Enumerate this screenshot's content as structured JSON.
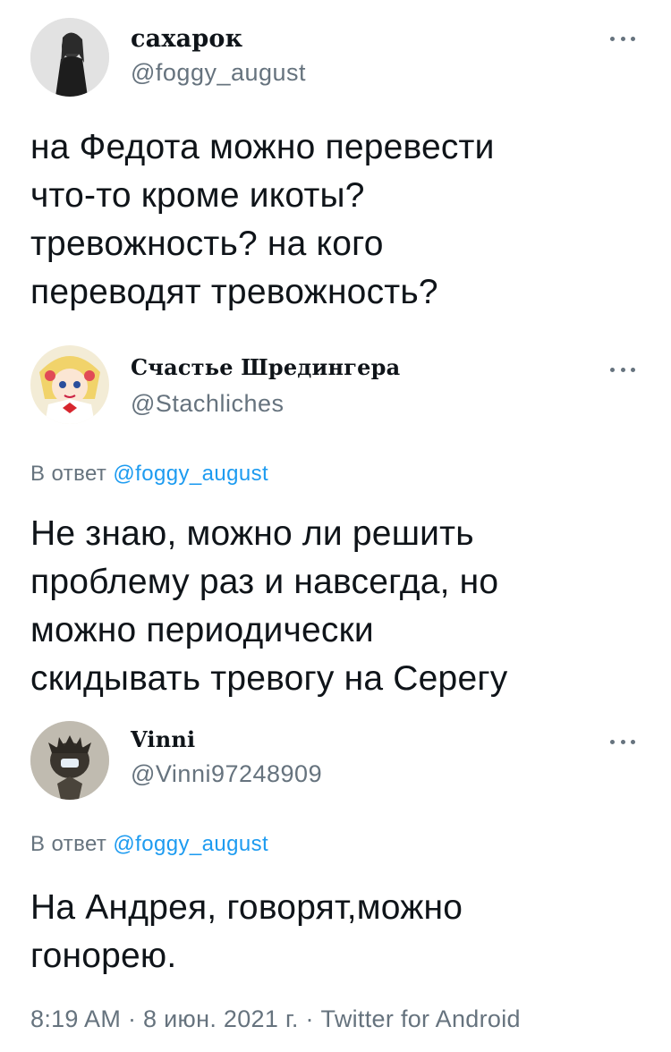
{
  "tweets": [
    {
      "display_name": "сахарок",
      "handle": "@foggy_august",
      "text_lines": [
        "на Федота можно перевести",
        "что-то кроме икоты?",
        "тревожность? на кого",
        "переводят тревожность?"
      ]
    },
    {
      "display_name": "Счастье Шредингера",
      "handle": "@Stachliches",
      "reply_prefix": "В ответ",
      "reply_mention": "@foggy_august",
      "text_lines": [
        "Не знаю, можно ли решить",
        "проблему раз и навсегда, но",
        "можно периодически",
        "скидывать тревогу на Серегу"
      ]
    },
    {
      "display_name": "Vinni",
      "handle": "@Vinni97248909",
      "reply_prefix": "В ответ",
      "reply_mention": "@foggy_august",
      "text_lines": [
        "На Андрея, говорят,можно",
        "гонорею."
      ]
    }
  ],
  "footer": {
    "text": "8:19 AM · 8 июн. 2021 г. · Twitter for Android"
  },
  "icons": {
    "more": "more-dots-icon"
  },
  "colors": {
    "text": "#0f1419",
    "secondary": "#66737e",
    "mention": "#1d9bf0"
  }
}
